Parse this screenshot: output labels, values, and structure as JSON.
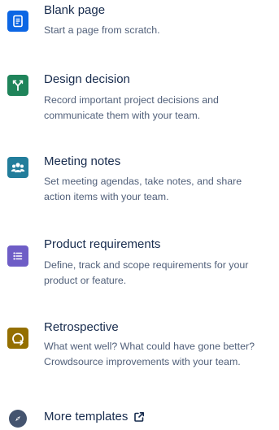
{
  "templates": [
    {
      "title": "Blank page",
      "description_lines": [
        "Start a page from scratch."
      ],
      "icon": "document-icon",
      "color": "#0c66e4"
    },
    {
      "title": "Design decision",
      "description_lines": [
        "Record important project decisions and",
        "communicate them with your team."
      ],
      "icon": "merge-arrows-icon",
      "color": "#1f845a"
    },
    {
      "title": "Meeting notes",
      "description_lines": [
        "Set meeting agendas, take notes, and share",
        "action items with your team."
      ],
      "icon": "people-group-icon",
      "color": "#227d9b"
    },
    {
      "title": "Product requirements",
      "description_lines": [
        "Define, track and scope requirements for your",
        "product or feature."
      ],
      "icon": "list-icon",
      "color": "#6e5dc6"
    },
    {
      "title": "Retrospective",
      "description_lines": [
        "What went well? What could have gone better?",
        "Crowdsource improvements with your team."
      ],
      "icon": "refresh-cycle-icon",
      "color": "#946f00"
    }
  ],
  "more_templates": {
    "label": "More templates",
    "icon": "compass-icon",
    "external_icon": "external-link-icon",
    "color": "#44546f"
  }
}
